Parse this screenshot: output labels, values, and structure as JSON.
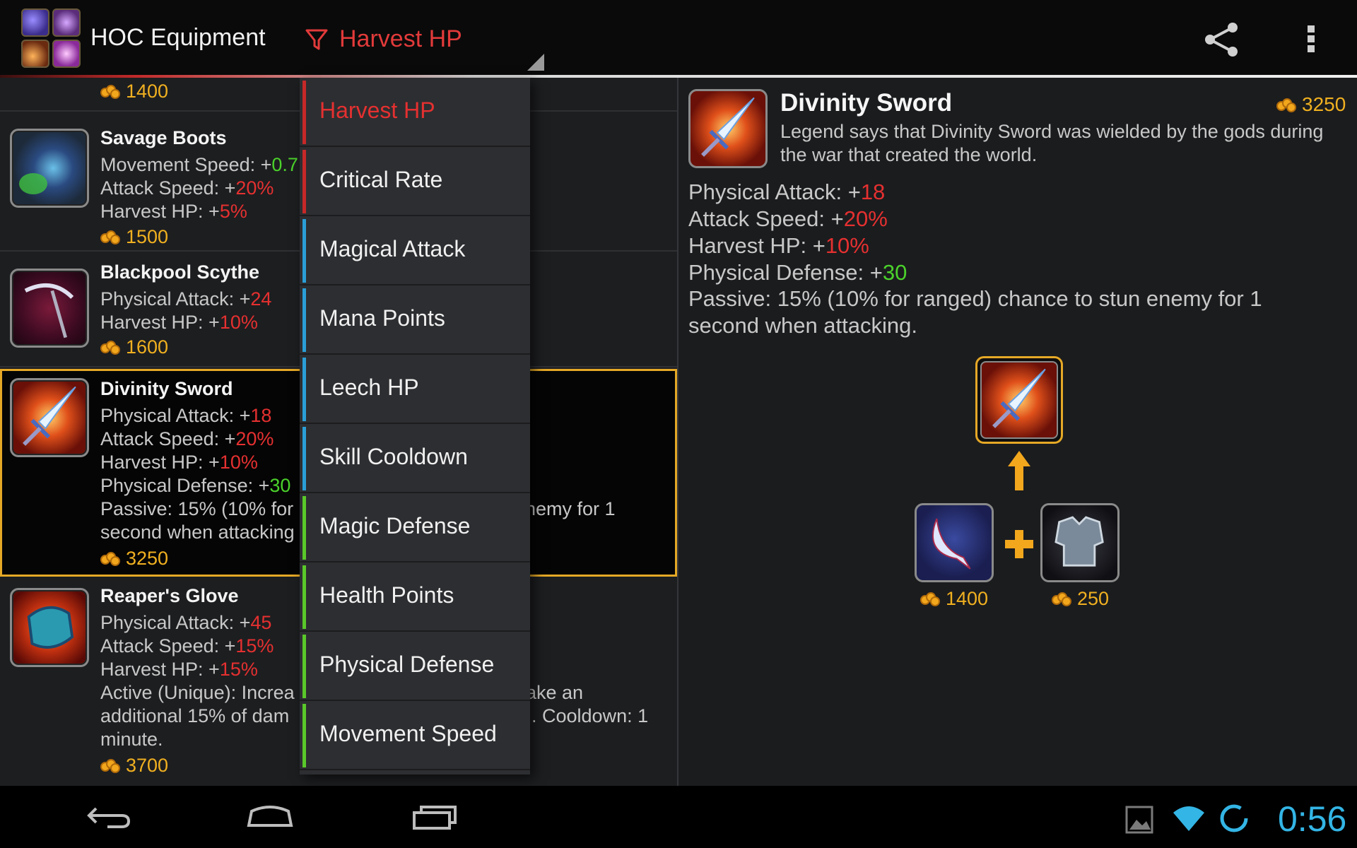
{
  "app": {
    "title": "HOC Equipment"
  },
  "filter": {
    "label": "Harvest HP"
  },
  "list": {
    "top_price": "1400",
    "items": [
      {
        "name": "Savage Boots",
        "stats": [
          {
            "label": "Movement Speed: +",
            "value": "0.7",
            "color": "green"
          },
          {
            "label": "Attack Speed: +",
            "value": "20%",
            "color": "red"
          },
          {
            "label": "Harvest HP: +",
            "value": "5%",
            "color": "red"
          }
        ],
        "price": "1500"
      },
      {
        "name": "Blackpool Scythe",
        "stats": [
          {
            "label": "Physical Attack: +",
            "value": "24",
            "color": "red"
          },
          {
            "label": "Harvest HP: +",
            "value": "10%",
            "color": "red"
          }
        ],
        "price": "1600"
      },
      {
        "name": "Divinity Sword",
        "stats": [
          {
            "label": "Physical Attack: +",
            "value": "18",
            "color": "red"
          },
          {
            "label": "Attack Speed: +",
            "value": "20%",
            "color": "red"
          },
          {
            "label": "Harvest HP: +",
            "value": "10%",
            "color": "red"
          },
          {
            "label": "Physical Defense: +",
            "value": "30",
            "color": "green"
          }
        ],
        "passive_line1_left": "Passive: 15% (10% for",
        "passive_line1_right": "nemy for 1",
        "passive_line2": "second when attacking",
        "price": "3250"
      },
      {
        "name": "Reaper's Glove",
        "stats": [
          {
            "label": "Physical Attack: +",
            "value": "45",
            "color": "red"
          },
          {
            "label": "Attack Speed: +",
            "value": "15%",
            "color": "red"
          },
          {
            "label": "Harvest HP: +",
            "value": "15%",
            "color": "red"
          }
        ],
        "active_line1_left": "Active (Unique): Increa",
        "active_line1_right": "ake an",
        "active_line2_left": "additional 15% of dam",
        "active_line2_right": ". Cooldown: 1",
        "active_line3": "minute.",
        "price": "3700"
      }
    ]
  },
  "dropdown": {
    "items": [
      {
        "label": "Harvest HP",
        "bar": "#c62828",
        "active": true
      },
      {
        "label": "Critical Rate",
        "bar": "#c62828"
      },
      {
        "label": "Magical Attack",
        "bar": "#2a9fd6"
      },
      {
        "label": "Mana Points",
        "bar": "#2a9fd6"
      },
      {
        "label": "Leech HP",
        "bar": "#2a9fd6"
      },
      {
        "label": "Skill Cooldown",
        "bar": "#2a9fd6"
      },
      {
        "label": "Magic Defense",
        "bar": "#5ac82a"
      },
      {
        "label": "Health Points",
        "bar": "#5ac82a"
      },
      {
        "label": "Physical Defense",
        "bar": "#5ac82a"
      },
      {
        "label": "Movement Speed",
        "bar": "#5ac82a"
      }
    ]
  },
  "detail": {
    "name": "Divinity Sword",
    "price": "3250",
    "lore": "Legend says that Divinity Sword was wielded by the gods during the war that created the world.",
    "stats": [
      {
        "label": "Physical Attack: +",
        "value": "18",
        "color": "red"
      },
      {
        "label": "Attack Speed: +",
        "value": "20%",
        "color": "red"
      },
      {
        "label": "Harvest HP: +",
        "value": "10%",
        "color": "red"
      },
      {
        "label": "Physical Defense: +",
        "value": "30",
        "color": "green"
      }
    ],
    "passive": "Passive: 15% (10% for ranged) chance to stun enemy for 1 second when attacking.",
    "recipe": {
      "left_price": "1400",
      "right_price": "250"
    }
  },
  "status": {
    "clock": "0:56"
  },
  "colors": {
    "accent_red": "#e53030",
    "accent_green": "#4bd22b",
    "gold": "#f0b020",
    "selection": "#e5a826",
    "clock_blue": "#33b5e5"
  }
}
